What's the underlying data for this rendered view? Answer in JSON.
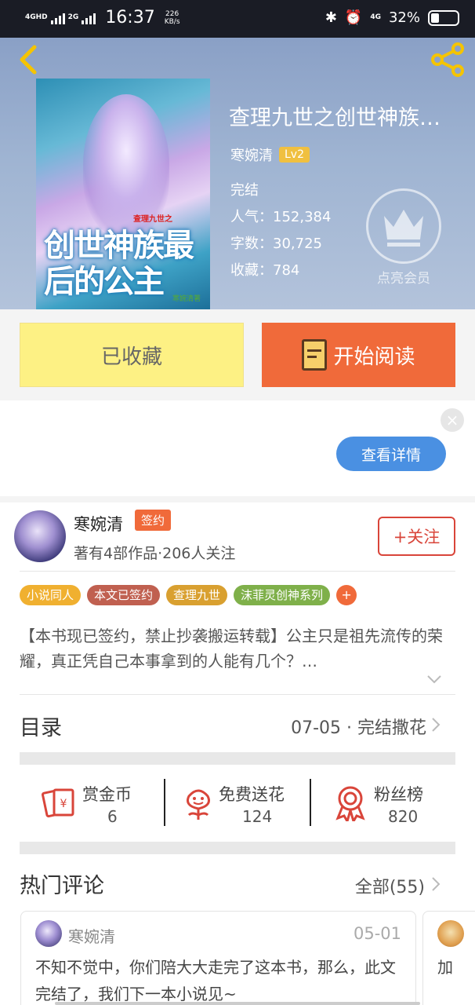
{
  "status_bar": {
    "network_1": "4GHD",
    "network_2": "2G",
    "time": "16:37",
    "speed_value": "226",
    "speed_unit": "KB/s",
    "network_right": "4G",
    "battery": "32%"
  },
  "book": {
    "cover_subtitle": "查理九世之",
    "cover_title": "创世神族最后的公主",
    "cover_author": "寒婉清著",
    "title": "查理九世之创世神族…",
    "author": "寒婉清",
    "level": "Lv2",
    "status": "完结",
    "popularity_label": "人气：",
    "popularity": "152,384",
    "words_label": "字数：",
    "words": "30,725",
    "favorites_label": "收藏：",
    "favorites": "784",
    "vip_label": "点亮会员"
  },
  "actions": {
    "collected_label": "已收藏",
    "read_label": "开始阅读"
  },
  "ad": {
    "close_label": "×",
    "details_label": "查看详情"
  },
  "author_card": {
    "name": "寒婉清",
    "sign_badge": "签约",
    "meta": "著有4部作品·206人关注",
    "follow_label": "+关注"
  },
  "tags": [
    {
      "label": "小说同人",
      "color": "#f0b030"
    },
    {
      "label": "本文已签约",
      "color": "#c06050"
    },
    {
      "label": "查理九世",
      "color": "#d9a030"
    },
    {
      "label": "沫菲灵创神系列",
      "color": "#7fb04a"
    }
  ],
  "tags_more": "+",
  "synopsis": "【本书现已签约，禁止抄袭搬运转载】公主只是祖先流传的荣耀，真正凭自己本事拿到的人能有几个？…",
  "toc": {
    "label": "目录",
    "latest": "07-05 · 完结撒花"
  },
  "stats": [
    {
      "label": "赏金币",
      "value": "6",
      "icon": "gold-coin-icon"
    },
    {
      "label": "免费送花",
      "value": "124",
      "icon": "flower-icon"
    },
    {
      "label": "粉丝榜",
      "value": "820",
      "icon": "medal-icon"
    }
  ],
  "comments": {
    "title": "热门评论",
    "all_label": "全部(55)",
    "items": [
      {
        "user": "寒婉清",
        "date": "05-01",
        "text": "不知不觉中，你们陪大大走完了这本书，那么，此文完结了，我们下一本小说见~"
      },
      {
        "user": "",
        "date": "",
        "text": "加"
      }
    ]
  },
  "colors": {
    "accent_orange": "#f06a3a",
    "collected_yellow": "#fdf184",
    "follow_red": "#d9453a",
    "details_blue": "#4a90e2"
  }
}
